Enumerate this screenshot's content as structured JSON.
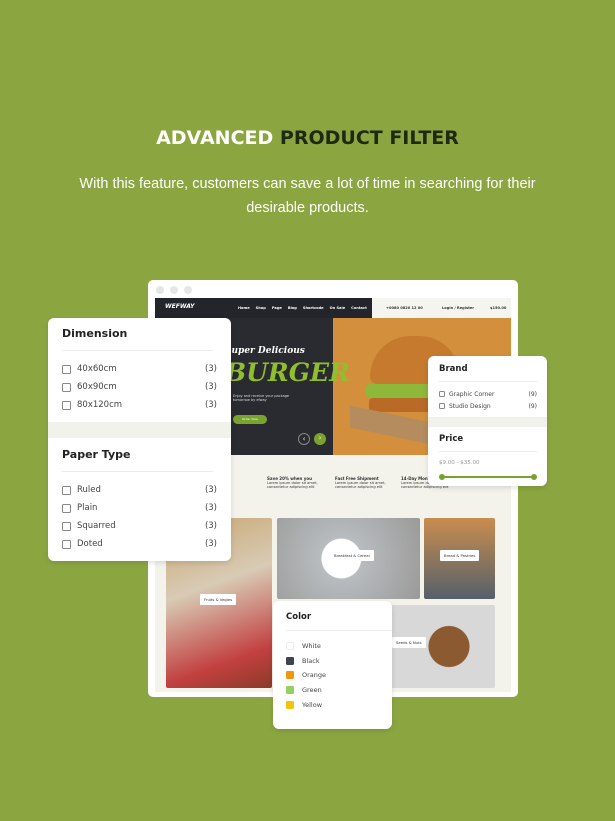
{
  "heading": {
    "part1": "ADVANCED",
    "part2": "PRODUCT FILTER"
  },
  "subtitle": "With this feature, customers can save a lot of time in searching for their desirable products.",
  "site": {
    "logo": "WEFWAY",
    "nav": [
      "Home",
      "Shop",
      "Page",
      "Blog",
      "Shortcode",
      "On Sale",
      "Contact"
    ],
    "hotline": "+0080 0820 12 00",
    "login": "Login / Register",
    "cart_total": "$150.00",
    "hero": {
      "line1": "Super Delicious",
      "line2": "BURGER",
      "text": "Enjoy and receive your package tomorrow by efway",
      "button": "Order Now"
    },
    "features": [
      {
        "title": "Save 20% when you",
        "text": "Lorem ipsum dolor sit amet, consectetur adipiscing elit"
      },
      {
        "title": "Fast Free Shipment",
        "text": "Lorem ipsum dolor sit amet, consectetur adipiscing elit"
      },
      {
        "title": "14-Day Money back",
        "text": "Lorem ipsum dolor sit amet, consectetur adipiscing elit"
      }
    ],
    "categories": [
      "Fruits & Vegies",
      "Breakfast & Cereal",
      "Bread & Pastries",
      "Seeds & Nuts"
    ]
  },
  "dimension": {
    "title": "Dimension",
    "items": [
      {
        "label": "40x60cm",
        "count": "(3)"
      },
      {
        "label": "60x90cm",
        "count": "(3)"
      },
      {
        "label": "80x120cm",
        "count": "(3)"
      }
    ]
  },
  "paper_type": {
    "title": "Paper Type",
    "items": [
      {
        "label": "Ruled",
        "count": "(3)"
      },
      {
        "label": "Plain",
        "count": "(3)"
      },
      {
        "label": "Squarred",
        "count": "(3)"
      },
      {
        "label": "Doted",
        "count": "(3)"
      }
    ]
  },
  "brand": {
    "title": "Brand",
    "items": [
      {
        "label": "Graphic Corner",
        "count": "(9)"
      },
      {
        "label": "Studio Design",
        "count": "(9)"
      }
    ]
  },
  "price": {
    "title": "Price",
    "range": "$9.00 - $35.00",
    "min": 9,
    "max": 35
  },
  "color": {
    "title": "Color",
    "items": [
      {
        "label": "White",
        "hex": "#ffffff"
      },
      {
        "label": "Black",
        "hex": "#3d4450"
      },
      {
        "label": "Orange",
        "hex": "#f0960f"
      },
      {
        "label": "Green",
        "hex": "#93d162"
      },
      {
        "label": "Yellow",
        "hex": "#f2c30f"
      }
    ]
  },
  "colors": {
    "background": "#8ba641",
    "accent": "#7aa32e"
  }
}
